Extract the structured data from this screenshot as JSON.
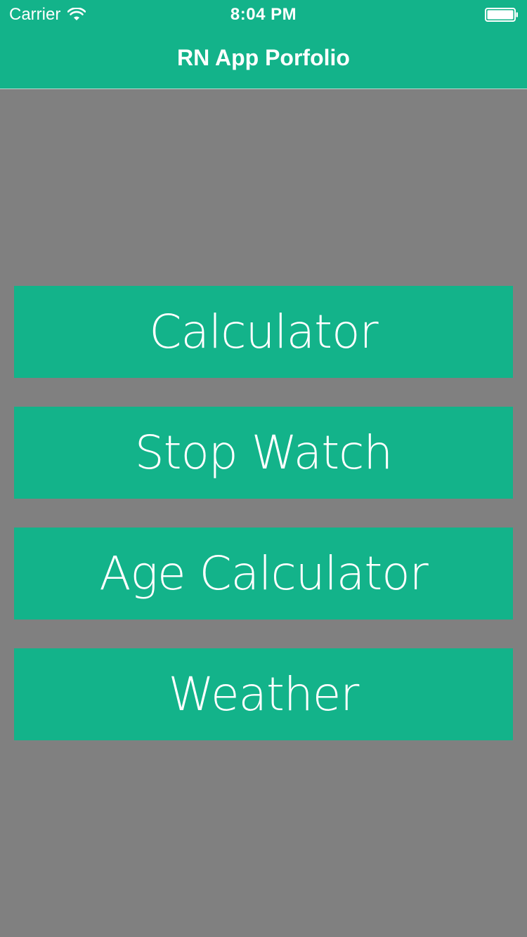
{
  "status_bar": {
    "carrier": "Carrier",
    "time": "8:04 PM",
    "wifi_icon": "wifi-icon",
    "battery_icon": "battery-icon"
  },
  "nav": {
    "title": "RN App Porfolio"
  },
  "menu": {
    "items": [
      {
        "label": "Calculator"
      },
      {
        "label": "Stop Watch"
      },
      {
        "label": "Age Calculator"
      },
      {
        "label": "Weather"
      }
    ]
  },
  "colors": {
    "accent": "#13b38a",
    "background": "#808080",
    "text": "#ffffff"
  }
}
